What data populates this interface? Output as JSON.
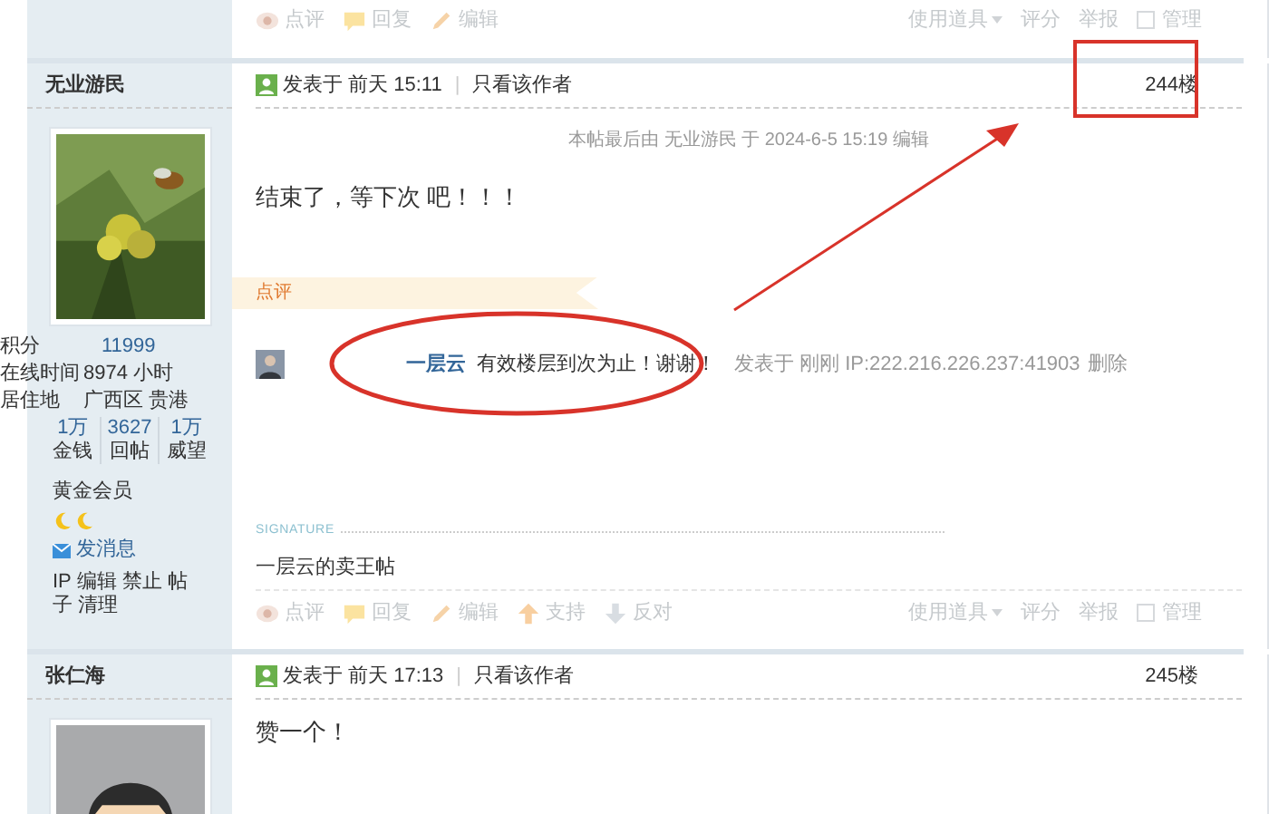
{
  "top_actions": {
    "left": [
      {
        "kind": "comment",
        "label": "点评"
      },
      {
        "kind": "reply",
        "label": "回复"
      },
      {
        "kind": "edit",
        "label": "编辑"
      }
    ],
    "right": [
      {
        "kind": "menu",
        "label": "使用道具"
      },
      {
        "kind": "link",
        "label": "评分"
      },
      {
        "kind": "link",
        "label": "举报"
      },
      {
        "kind": "check",
        "label": "管理",
        "checked": false
      }
    ]
  },
  "posts": [
    {
      "author": "无业游民",
      "avatar": {
        "kind": "picture"
      },
      "stats": [
        {
          "label": "积分",
          "value": "11999",
          "kind": "link"
        },
        {
          "label": "在线时间",
          "value": "8974 小时",
          "kind": "plain"
        },
        {
          "label": "居住地",
          "value": "广西区 贵港",
          "kind": "plain"
        }
      ],
      "counters": [
        {
          "value": "1万",
          "label": "金钱"
        },
        {
          "value": "3627",
          "label": "回帖"
        },
        {
          "value": "1万",
          "label": "威望"
        }
      ],
      "group": "黄金会员",
      "medals": [
        {
          "kind": "moon"
        },
        {
          "kind": "moon"
        }
      ],
      "message": "发消息",
      "admin": "IP 编辑 禁止 帖子 清理",
      "posted": "发表于 前天 15:11",
      "separator": "|",
      "author_only": "只看该作者",
      "floor": "244楼",
      "edit_note": "本帖最后由 无业游民 于 2024-6-5 15:19 编辑",
      "body": "结束了，等下次 吧！！！",
      "review_label": "点评",
      "comments": [
        {
          "user": "一层云",
          "text": "有效楼层到次为止！谢谢！",
          "meta": "发表于 刚刚 IP:222.216.226.237:41903",
          "delete": "删除"
        }
      ],
      "signature_label": "SIGNATURE",
      "signature": "一层云的卖王帖",
      "actions": {
        "left": [
          {
            "kind": "comment",
            "label": "点评"
          },
          {
            "kind": "reply",
            "label": "回复"
          },
          {
            "kind": "edit",
            "label": "编辑"
          },
          {
            "kind": "up",
            "label": "支持"
          },
          {
            "kind": "down",
            "label": "反对"
          }
        ],
        "right": [
          {
            "kind": "menu",
            "label": "使用道具"
          },
          {
            "kind": "link",
            "label": "评分"
          },
          {
            "kind": "link",
            "label": "举报"
          },
          {
            "kind": "check",
            "label": "管理",
            "checked": false
          }
        ]
      }
    },
    {
      "author": "张仁海",
      "avatar": {
        "kind": "cartoon"
      },
      "posted": "发表于 前天 17:13",
      "separator": "|",
      "author_only": "只看该作者",
      "floor": "245楼",
      "body": "赞一个！"
    }
  ],
  "annotations": [
    {
      "kind": "rect"
    },
    {
      "kind": "arrow"
    },
    {
      "kind": "ellipse"
    }
  ]
}
